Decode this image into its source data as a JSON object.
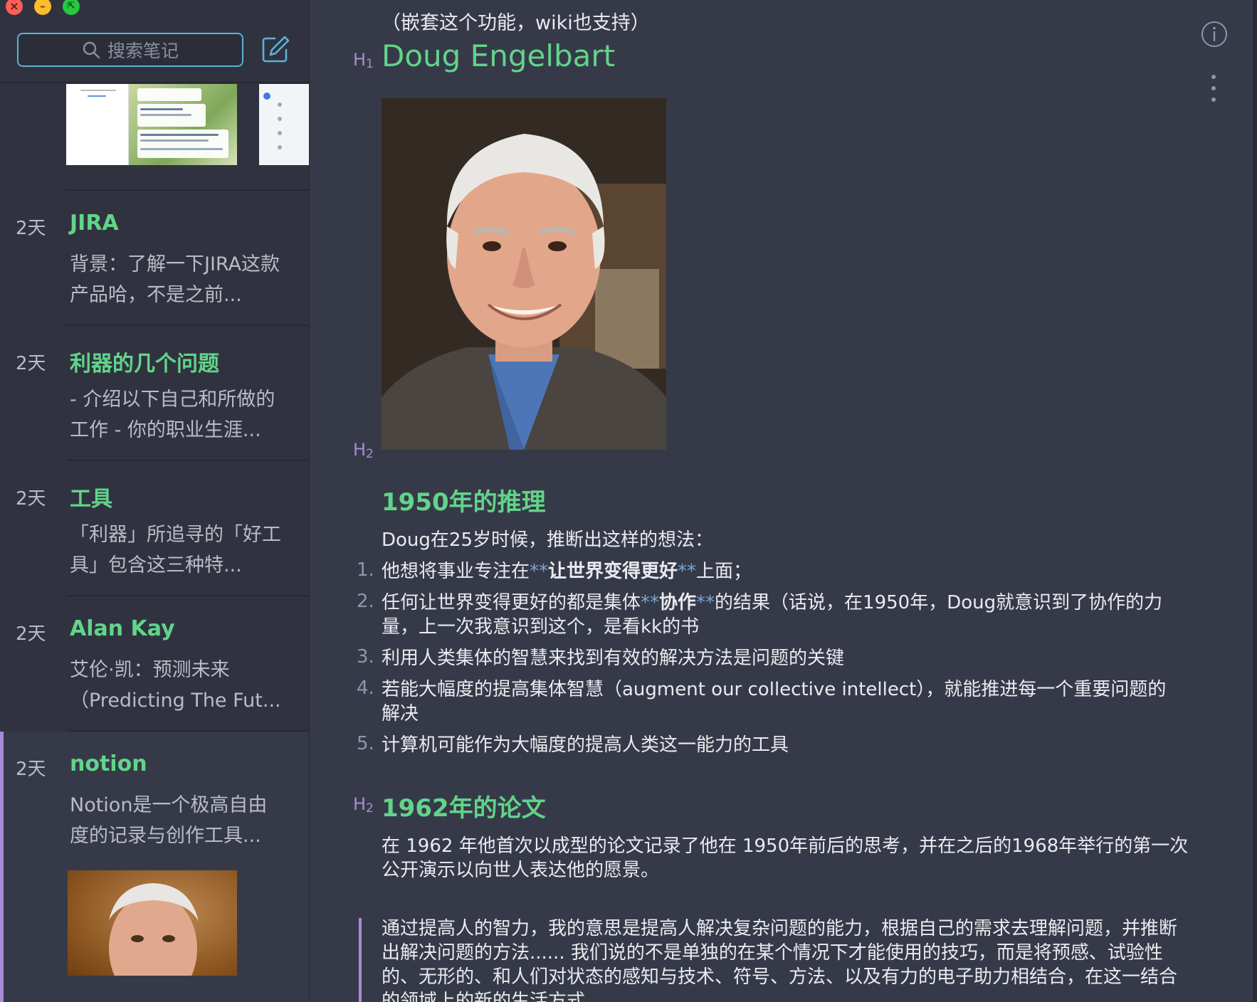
{
  "sidebar": {
    "search_placeholder": "搜索笔记",
    "notes": [
      {
        "date": "2天",
        "title": "JIRA",
        "snippet": "背景：了解一下JIRA这款产品哈，不是之前..."
      },
      {
        "date": "2天",
        "title": "利器的几个问题",
        "snippet": "- 介绍以下自己和所做的工作 - 你的职业生涯..."
      },
      {
        "date": "2天",
        "title": "工具",
        "snippet": "「利器」所追寻的「好工具」包含这三种特..."
      },
      {
        "date": "2天",
        "title": "Alan Kay",
        "snippet": "艾伦·凯：预测未来（Predicting The Fut..."
      },
      {
        "date": "2天",
        "title": "notion",
        "snippet": "Notion是一个极高自由度的记录与创作工具..."
      }
    ]
  },
  "editor": {
    "intro": "（嵌套这个功能，wiki也支持）",
    "h1_marker": "H",
    "h1_level": "1",
    "h2_marker": "H",
    "h2_level": "2",
    "title": "Doug Engelbart",
    "section1": {
      "heading": "1950年的推理",
      "lead": "Doug在25岁时候，推断出这样的想法：",
      "items": [
        {
          "num": "1.",
          "pre": "他想将事业专注在",
          "mk1": "**",
          "bold": "让世界变得更好",
          "mk2": "**",
          "post": "上面；"
        },
        {
          "num": "2.",
          "pre": "任何让世界变得更好的都是集体",
          "mk1": "**",
          "bold": "协作",
          "mk2": "**",
          "post": "的结果（话说，在1950年，Doug就意识到了协作的力量，上一次我意识到这个，是看kk的书"
        },
        {
          "num": "3.",
          "text": "利用人类集体的智慧来找到有效的解决方法是问题的关键"
        },
        {
          "num": "4.",
          "text": "若能大幅度的提高集体智慧（augment our collective intellect），就能推进每一个重要问题的解决"
        },
        {
          "num": "5.",
          "text": "计算机可能作为大幅度的提高人类这一能力的工具"
        }
      ]
    },
    "section2": {
      "heading": "1962年的论文",
      "para": "在 1962 年他首次以成型的论文记录了他在 1950年前后的思考，并在之后的1968年举行的第一次公开演示以向世人表达他的愿景。",
      "quote": "通过提高人的智力，我的意思是提高人解决复杂问题的能力，根据自己的需求去理解问题，并推断出解决问题的方法...... 我们说的不是单独的在某个情况下才能使用的技巧，而是将预感、试验性的、无形的、和人们对状态的感知与技术、符号、方法、以及有力的电子助力相结合，在这一结合的领域上的新的生活方式。"
    }
  },
  "colors": {
    "accent_green": "#61d48a",
    "accent_purple": "#a98bd8",
    "search_border": "#5ab1dc"
  }
}
